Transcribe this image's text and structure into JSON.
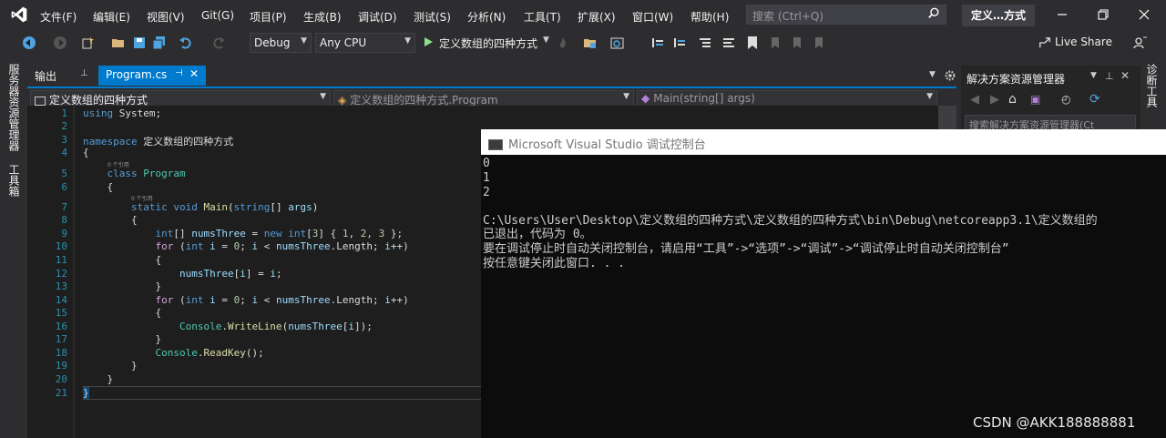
{
  "menu": {
    "items": [
      "文件(F)",
      "编辑(E)",
      "视图(V)",
      "Git(G)",
      "项目(P)",
      "生成(B)",
      "调试(D)",
      "测试(S)",
      "分析(N)",
      "工具(T)",
      "扩展(X)",
      "窗口(W)",
      "帮助(H)"
    ],
    "search_placeholder": "搜索 (Ctrl+Q)",
    "solution_title": "定义…方式"
  },
  "toolbar": {
    "config": "Debug",
    "platform": "Any CPU",
    "start_target": "定义数组的四种方式",
    "live_share": "Live Share"
  },
  "left_rail": {
    "server_explorer": "服务器资源管理器",
    "toolbox": "工具箱"
  },
  "right_rail": {
    "diagnostics": "诊断工具"
  },
  "tabs": {
    "output": "输出",
    "program": "Program.cs"
  },
  "nav": {
    "project": "定义数组的四种方式",
    "class": "定义数组的四种方式.Program",
    "member": "Main(string[] args)"
  },
  "editor": {
    "line_numbers": [
      "1",
      "2",
      "3",
      "4",
      "5",
      "6",
      "7",
      "8",
      "9",
      "10",
      "11",
      "12",
      "13",
      "14",
      "15",
      "16",
      "17",
      "18",
      "19",
      "20",
      "21"
    ],
    "ref_hint": "0 个引用"
  },
  "solution_explorer": {
    "title": "解决方案资源管理器",
    "search_placeholder": "搜索解决方案资源管理器(Ct"
  },
  "console": {
    "title": "Microsoft Visual Studio 调试控制台",
    "lines": [
      "0",
      "1",
      "2",
      "",
      "C:\\Users\\User\\Desktop\\定义数组的四种方式\\定义数组的四种方式\\bin\\Debug\\netcoreapp3.1\\定义数组的",
      "已退出，代码为 0。",
      "要在调试停止时自动关闭控制台，请启用“工具”->“选项”->“调试”->“调试停止时自动关闭控制台”",
      "按任意键关闭此窗口. . ."
    ]
  },
  "watermark": "CSDN @AKK188888881",
  "colors": {
    "accent": "#007acc",
    "background": "#2d2d30",
    "editor_bg": "#1e1e1e",
    "console_bg": "#0c0c0c"
  }
}
